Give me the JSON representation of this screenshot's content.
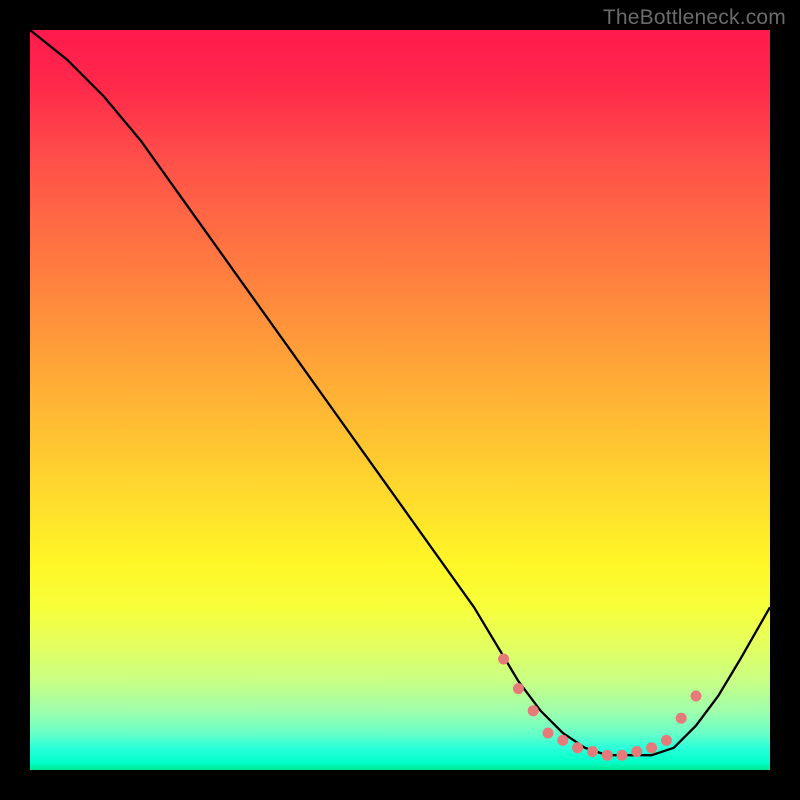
{
  "watermark": "TheBottleneck.com",
  "chart_data": {
    "type": "line",
    "title": "",
    "xlabel": "",
    "ylabel": "",
    "xlim": [
      0,
      100
    ],
    "ylim": [
      0,
      100
    ],
    "grid": false,
    "series": [
      {
        "name": "curve",
        "color": "#000000",
        "x": [
          0,
          5,
          10,
          15,
          20,
          25,
          30,
          35,
          40,
          45,
          50,
          55,
          60,
          63,
          66,
          69,
          72,
          75,
          78,
          81,
          84,
          87,
          90,
          93,
          96,
          100
        ],
        "y": [
          100,
          96,
          91,
          85,
          78,
          71,
          64,
          57,
          50,
          43,
          36,
          29,
          22,
          17,
          12,
          8,
          5,
          3,
          2,
          2,
          2,
          3,
          6,
          10,
          15,
          22
        ]
      }
    ],
    "markers": {
      "name": "highlight-points",
      "color": "#e67a7a",
      "points": [
        {
          "x": 64,
          "y": 15
        },
        {
          "x": 66,
          "y": 11
        },
        {
          "x": 68,
          "y": 8
        },
        {
          "x": 70,
          "y": 5
        },
        {
          "x": 72,
          "y": 4
        },
        {
          "x": 74,
          "y": 3
        },
        {
          "x": 76,
          "y": 2.5
        },
        {
          "x": 78,
          "y": 2
        },
        {
          "x": 80,
          "y": 2
        },
        {
          "x": 82,
          "y": 2.5
        },
        {
          "x": 84,
          "y": 3
        },
        {
          "x": 86,
          "y": 4
        },
        {
          "x": 88,
          "y": 7
        },
        {
          "x": 90,
          "y": 10
        }
      ]
    }
  },
  "colors": {
    "background": "#000000",
    "curve": "#000000",
    "marker": "#e67a7a",
    "watermark": "#6b6b6b"
  }
}
